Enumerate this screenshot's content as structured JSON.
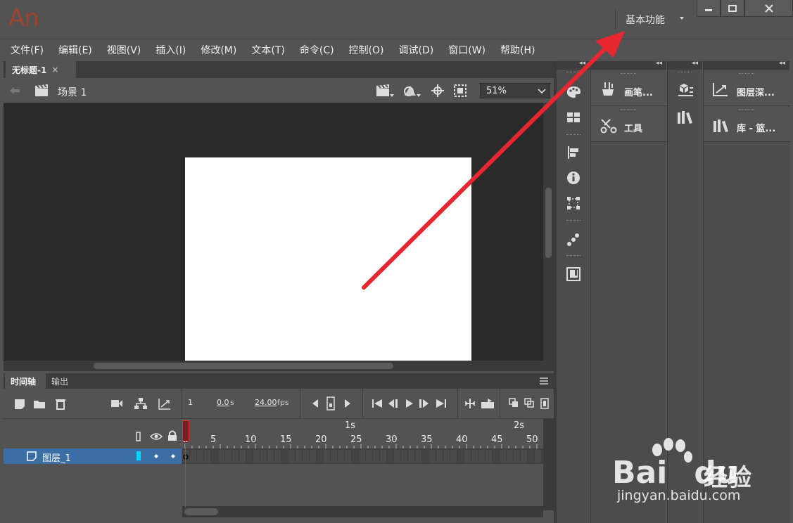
{
  "app": {
    "logo": "An",
    "workspace": "基本功能",
    "window_controls": [
      "minimize-icon",
      "maximize-icon",
      "close-icon"
    ]
  },
  "menu": [
    "文件(F)",
    "编辑(E)",
    "视图(V)",
    "插入(I)",
    "修改(M)",
    "文本(T)",
    "命令(C)",
    "控制(O)",
    "调试(D)",
    "窗口(W)",
    "帮助(H)"
  ],
  "document": {
    "tab_title": "无标题-1",
    "tab_close": "×",
    "scene": "场景 1",
    "zoom": "51%"
  },
  "timeline": {
    "tabs": [
      "时间轴",
      "输出"
    ],
    "current_frame": "1",
    "elapsed": "0.0",
    "elapsed_unit": "s",
    "fps": "24.00",
    "fps_unit": "fps",
    "ruler": [
      "1",
      "5",
      "10",
      "15",
      "20",
      "25",
      "30",
      "35",
      "40",
      "45",
      "50"
    ],
    "seconds": [
      "1s",
      "2s"
    ],
    "layer": {
      "name": "图层_1",
      "color": "#00d8ff"
    }
  },
  "panels": {
    "col2": [
      "画笔...",
      "工具"
    ],
    "col4": [
      "图层深...",
      "库 - 篮..."
    ]
  },
  "watermark": {
    "brand": "Bai",
    "brand2": "du",
    "cn": "经验",
    "url": "jingyan.baidu.com"
  },
  "colors": {
    "accent": "#3a6ea5",
    "annotation_arrow": "#e8262f",
    "logo": "#a0432e"
  }
}
